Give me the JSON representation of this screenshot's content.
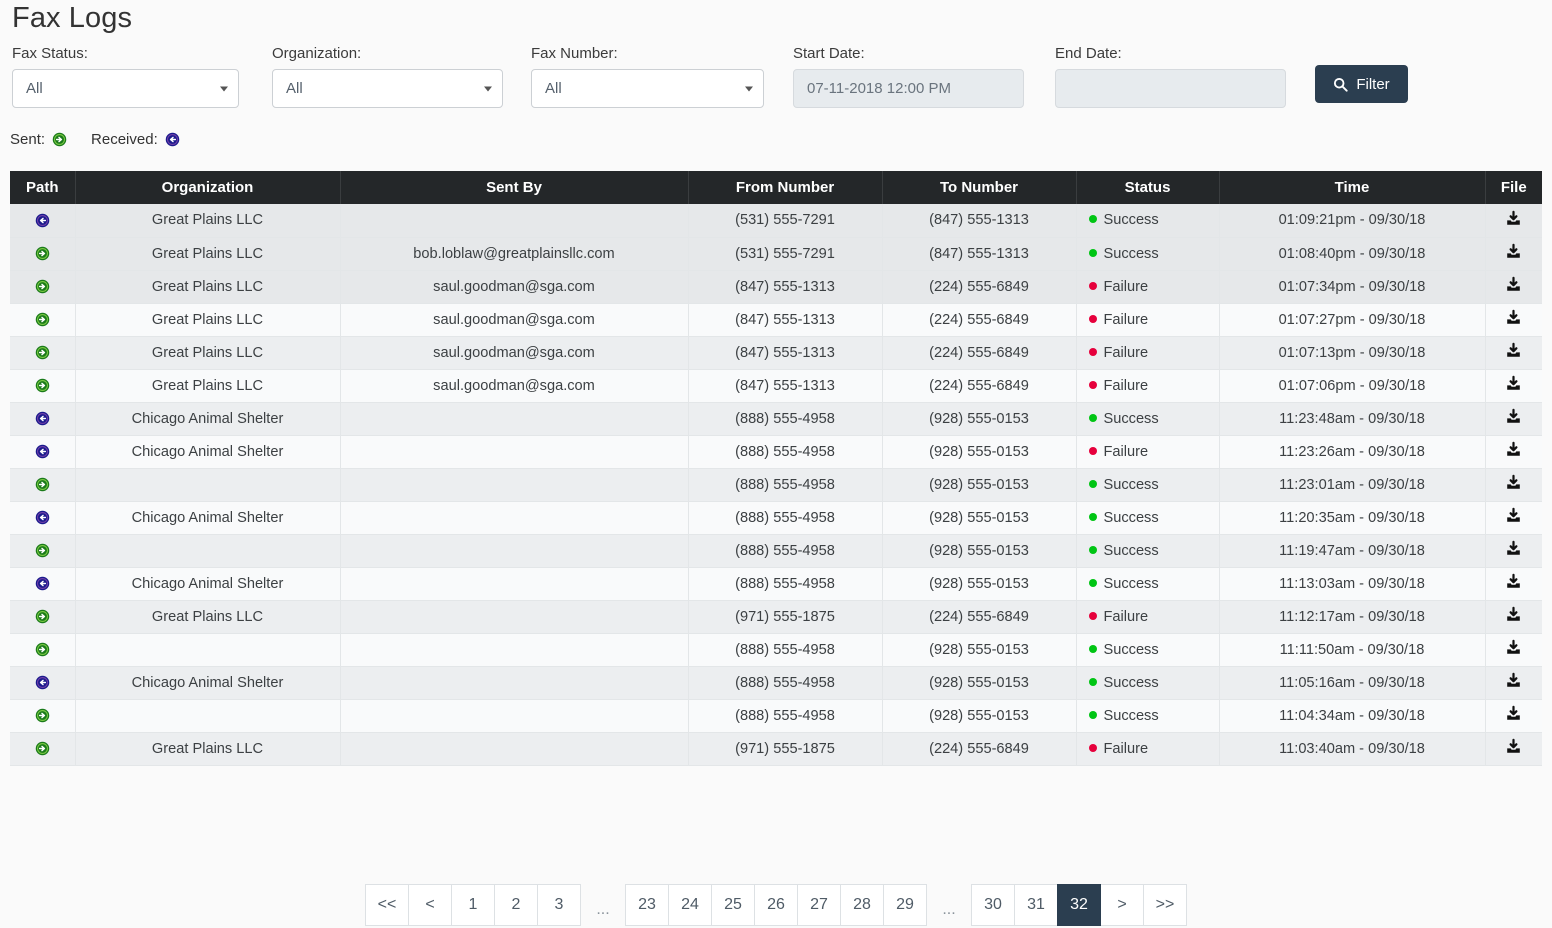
{
  "page": {
    "title": "Fax Logs"
  },
  "filters": {
    "fax_status": {
      "label": "Fax Status:",
      "value": "All"
    },
    "organization": {
      "label": "Organization:",
      "value": "All"
    },
    "fax_number": {
      "label": "Fax Number:",
      "value": "All"
    },
    "start_date": {
      "label": "Start Date:",
      "value": "07-11-2018 12:00 PM",
      "placeholder": ""
    },
    "end_date": {
      "label": "End Date:",
      "value": "",
      "placeholder": ""
    },
    "filter_button": {
      "label": "Filter",
      "icon": "search-icon",
      "color": "#2b3e50"
    }
  },
  "legend": {
    "sent_label": "Sent:",
    "sent_icon": "arrow-circle-right-icon",
    "sent_color": "#1a7a1a",
    "received_label": "Received:",
    "received_icon": "arrow-circle-left-icon",
    "received_color": "#1a1a8c"
  },
  "table": {
    "columns": [
      "Path",
      "Organization",
      "Sent By",
      "From Number",
      "To Number",
      "Status",
      "Time",
      "File"
    ],
    "status_colors": {
      "Success": "#00c514",
      "Failure": "#e6003c"
    },
    "rows": [
      {
        "path": "received",
        "organization": "Great Plains LLC",
        "sent_by": "",
        "from_number": "(531) 555-7291",
        "to_number": "(847) 555-1313",
        "status": "Success",
        "time": "01:09:21pm - 09/30/18",
        "file": "download-icon"
      },
      {
        "path": "sent",
        "organization": "Great Plains LLC",
        "sent_by": "bob.loblaw@greatplainsllc.com",
        "from_number": "(531) 555-7291",
        "to_number": "(847) 555-1313",
        "status": "Success",
        "time": "01:08:40pm - 09/30/18",
        "file": "download-icon"
      },
      {
        "path": "sent",
        "organization": "Great Plains LLC",
        "sent_by": "saul.goodman@sga.com",
        "from_number": "(847) 555-1313",
        "to_number": "(224) 555-6849",
        "status": "Failure",
        "time": "01:07:34pm - 09/30/18",
        "file": "download-icon"
      },
      {
        "path": "sent",
        "organization": "Great Plains LLC",
        "sent_by": "saul.goodman@sga.com",
        "from_number": "(847) 555-1313",
        "to_number": "(224) 555-6849",
        "status": "Failure",
        "time": "01:07:27pm - 09/30/18",
        "file": "download-icon"
      },
      {
        "path": "sent",
        "organization": "Great Plains LLC",
        "sent_by": "saul.goodman@sga.com",
        "from_number": "(847) 555-1313",
        "to_number": "(224) 555-6849",
        "status": "Failure",
        "time": "01:07:13pm - 09/30/18",
        "file": "download-icon"
      },
      {
        "path": "sent",
        "organization": "Great Plains LLC",
        "sent_by": "saul.goodman@sga.com",
        "from_number": "(847) 555-1313",
        "to_number": "(224) 555-6849",
        "status": "Failure",
        "time": "01:07:06pm - 09/30/18",
        "file": "download-icon"
      },
      {
        "path": "received",
        "organization": "Chicago Animal Shelter",
        "sent_by": "",
        "from_number": "(888) 555-4958",
        "to_number": "(928) 555-0153",
        "status": "Success",
        "time": "11:23:48am - 09/30/18",
        "file": "download-icon"
      },
      {
        "path": "received",
        "organization": "Chicago Animal Shelter",
        "sent_by": "",
        "from_number": "(888) 555-4958",
        "to_number": "(928) 555-0153",
        "status": "Failure",
        "time": "11:23:26am - 09/30/18",
        "file": "download-icon"
      },
      {
        "path": "sent",
        "organization": "",
        "sent_by": "",
        "from_number": "(888) 555-4958",
        "to_number": "(928) 555-0153",
        "status": "Success",
        "time": "11:23:01am - 09/30/18",
        "file": "download-icon"
      },
      {
        "path": "received",
        "organization": "Chicago Animal Shelter",
        "sent_by": "",
        "from_number": "(888) 555-4958",
        "to_number": "(928) 555-0153",
        "status": "Success",
        "time": "11:20:35am - 09/30/18",
        "file": "download-icon"
      },
      {
        "path": "sent",
        "organization": "",
        "sent_by": "",
        "from_number": "(888) 555-4958",
        "to_number": "(928) 555-0153",
        "status": "Success",
        "time": "11:19:47am - 09/30/18",
        "file": "download-icon"
      },
      {
        "path": "received",
        "organization": "Chicago Animal Shelter",
        "sent_by": "",
        "from_number": "(888) 555-4958",
        "to_number": "(928) 555-0153",
        "status": "Success",
        "time": "11:13:03am - 09/30/18",
        "file": "download-icon"
      },
      {
        "path": "sent",
        "organization": "Great Plains LLC",
        "sent_by": "",
        "from_number": "(971) 555-1875",
        "to_number": "(224) 555-6849",
        "status": "Failure",
        "time": "11:12:17am - 09/30/18",
        "file": "download-icon"
      },
      {
        "path": "sent",
        "organization": "",
        "sent_by": "",
        "from_number": "(888) 555-4958",
        "to_number": "(928) 555-0153",
        "status": "Success",
        "time": "11:11:50am - 09/30/18",
        "file": "download-icon"
      },
      {
        "path": "received",
        "organization": "Chicago Animal Shelter",
        "sent_by": "",
        "from_number": "(888) 555-4958",
        "to_number": "(928) 555-0153",
        "status": "Success",
        "time": "11:05:16am - 09/30/18",
        "file": "download-icon"
      },
      {
        "path": "sent",
        "organization": "",
        "sent_by": "",
        "from_number": "(888) 555-4958",
        "to_number": "(928) 555-0153",
        "status": "Success",
        "time": "11:04:34am - 09/30/18",
        "file": "download-icon"
      },
      {
        "path": "sent",
        "organization": "Great Plains LLC",
        "sent_by": "",
        "from_number": "(971) 555-1875",
        "to_number": "(224) 555-6849",
        "status": "Failure",
        "time": "11:03:40am - 09/30/18",
        "file": "download-icon"
      }
    ]
  },
  "pagination": {
    "active": "32",
    "groups": [
      {
        "items": [
          "<<",
          "<",
          "1",
          "2",
          "3"
        ]
      },
      {
        "ellipsis": "..."
      },
      {
        "items": [
          "23",
          "24",
          "25",
          "26",
          "27",
          "28",
          "29"
        ]
      },
      {
        "ellipsis": "..."
      },
      {
        "items": [
          "30",
          "31",
          "32",
          ">",
          ">>"
        ]
      }
    ]
  }
}
